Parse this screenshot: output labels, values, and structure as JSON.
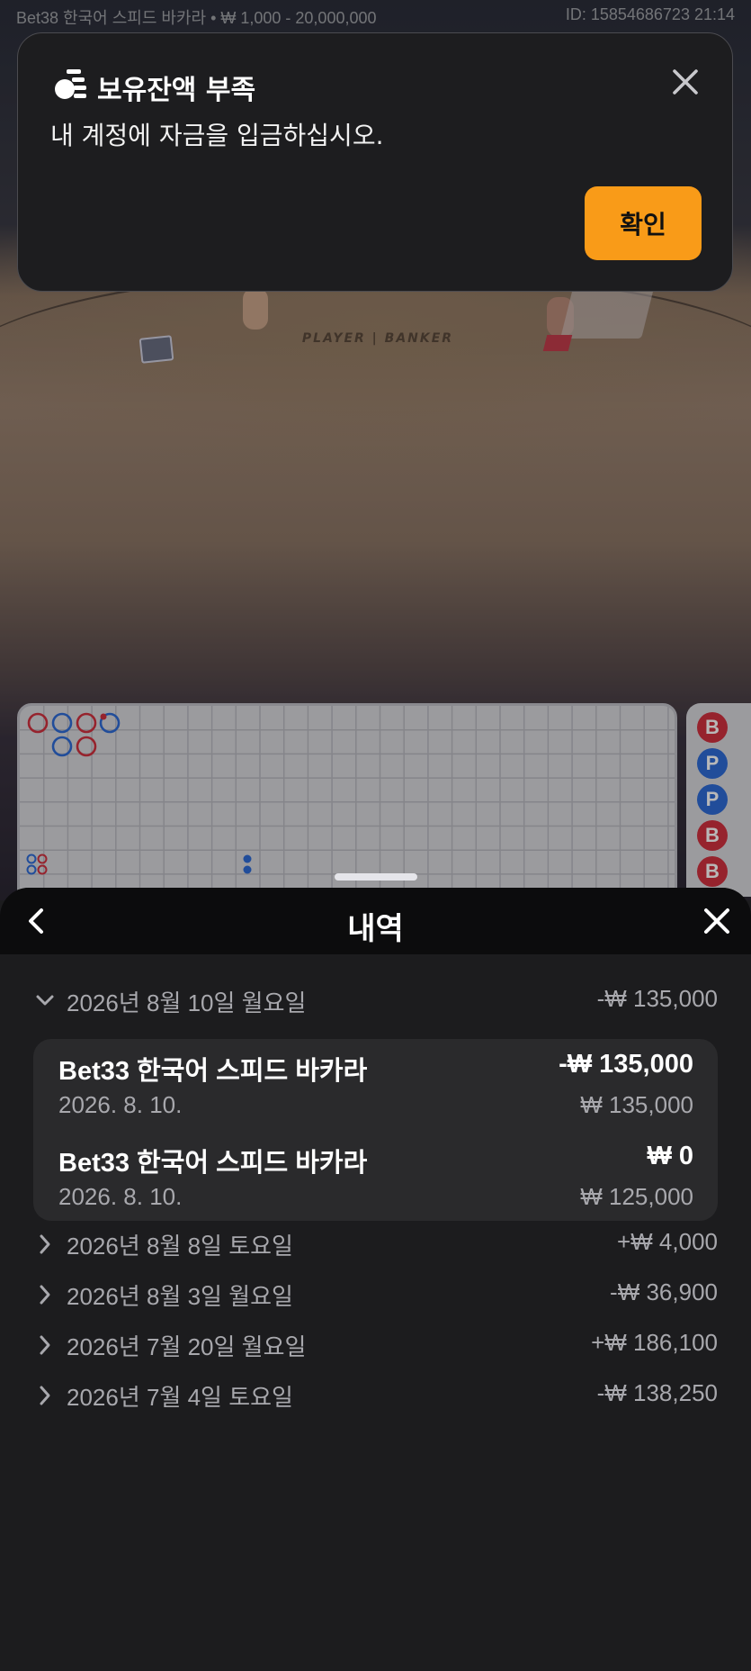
{
  "topbar": {
    "game_info": "Bet38 한국어 스피드 바카라 • ₩ 1,000 - 20,000,000",
    "session": "ID: 15854686723 21:14"
  },
  "video": {
    "table_label": "PLAYER | BANKER"
  },
  "alert": {
    "title": "보유잔액 부족",
    "message": "내 계정에 자금을 입금하십시오.",
    "confirm_label": "확인",
    "accent_color": "#f99b18"
  },
  "roadmap": {
    "bead_results": [
      "B",
      "P",
      "P",
      "B",
      "B"
    ],
    "colors": {
      "banker": "#d0313f",
      "player": "#2f6bd6"
    }
  },
  "history": {
    "title": "내역",
    "days": [
      {
        "date": "2026년 8월 10일 월요일",
        "total": "-₩ 135,000",
        "expanded": true,
        "transactions": [
          {
            "game": "Bet33 한국어 스피드 바카라",
            "amount": "-₩ 135,000",
            "date": "2026. 8. 10.",
            "balance": "₩ 135,000"
          },
          {
            "game": "Bet33 한국어 스피드 바카라",
            "amount": "₩ 0",
            "date": "2026. 8. 10.",
            "balance": "₩ 125,000"
          }
        ]
      },
      {
        "date": "2026년 8월 8일 토요일",
        "total": "+₩ 4,000",
        "expanded": false
      },
      {
        "date": "2026년 8월 3일 월요일",
        "total": "-₩ 36,900",
        "expanded": false
      },
      {
        "date": "2026년 7월 20일 월요일",
        "total": "+₩ 186,100",
        "expanded": false
      },
      {
        "date": "2026년 7월 4일 토요일",
        "total": "-₩ 138,250",
        "expanded": false
      }
    ]
  }
}
